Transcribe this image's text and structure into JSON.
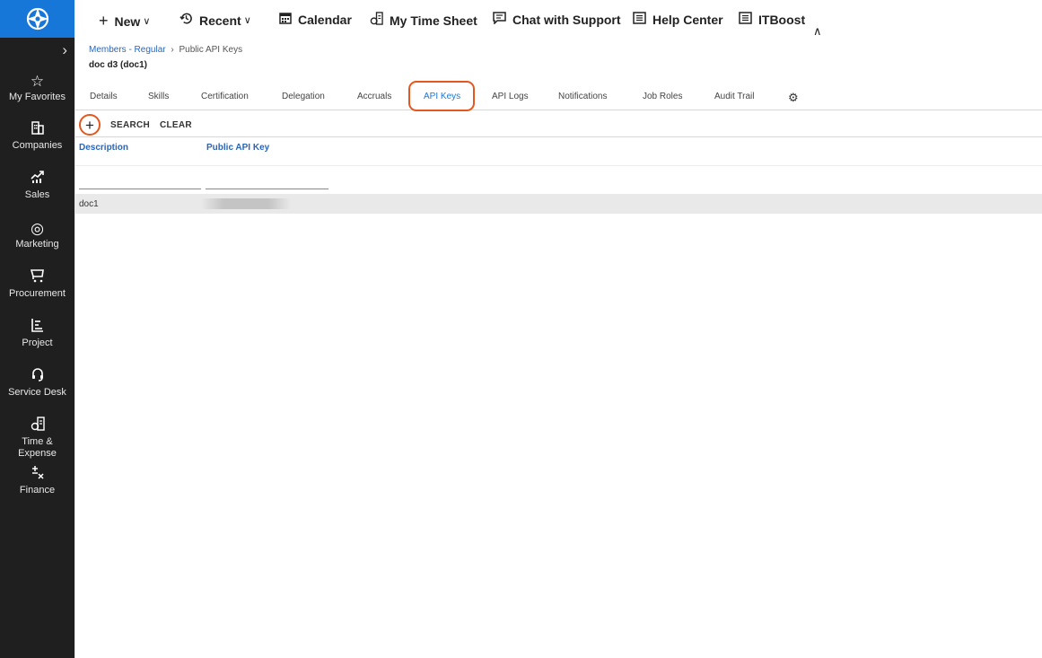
{
  "topbar": {
    "items": [
      {
        "icon": "plus-icon",
        "label": "New",
        "has_chevron": true
      },
      {
        "icon": "history-icon",
        "label": "Recent",
        "has_chevron": true
      },
      {
        "icon": "calendar-icon",
        "label": "Calendar"
      },
      {
        "icon": "timesheet-icon",
        "label": "My Time Sheet"
      },
      {
        "icon": "chat-icon",
        "label": "Chat with Support"
      },
      {
        "icon": "help-doc-icon",
        "label": "Help Center"
      },
      {
        "icon": "itboost-doc-icon",
        "label": "ITBoost"
      }
    ]
  },
  "sidebar": {
    "items": [
      {
        "icon": "star-icon",
        "label": "My Favorites"
      },
      {
        "icon": "building-icon",
        "label": "Companies"
      },
      {
        "icon": "sales-chart-icon",
        "label": "Sales"
      },
      {
        "icon": "target-icon",
        "label": "Marketing"
      },
      {
        "icon": "cart-icon",
        "label": "Procurement"
      },
      {
        "icon": "project-icon",
        "label": "Project"
      },
      {
        "icon": "headset-icon",
        "label": "Service Desk"
      },
      {
        "icon": "time-expense-icon",
        "label": "Time & Expense"
      },
      {
        "icon": "finance-icon",
        "label": "Finance"
      }
    ]
  },
  "breadcrumb": {
    "parent": "Members - Regular",
    "current": "Public API Keys"
  },
  "record": {
    "title": "doc d3 (doc1)"
  },
  "tabs": [
    {
      "label": "Details",
      "active": false
    },
    {
      "label": "Skills",
      "active": false
    },
    {
      "label": "Certification",
      "active": false
    },
    {
      "label": "Delegation",
      "active": false
    },
    {
      "label": "Accruals",
      "active": false
    },
    {
      "label": "API Keys",
      "active": true
    },
    {
      "label": "API Logs",
      "active": false
    },
    {
      "label": "Notifications",
      "active": false
    },
    {
      "label": "Job Roles",
      "active": false
    },
    {
      "label": "Audit Trail",
      "active": false
    }
  ],
  "toolbar": {
    "search_label": "SEARCH",
    "clear_label": "CLEAR"
  },
  "table": {
    "columns": [
      "Description",
      "Public API Key"
    ],
    "rows": [
      {
        "description": "doc1",
        "public_api_key": ""
      }
    ]
  },
  "colors": {
    "accent": "#1677d8",
    "sidebar_bg": "#1f1f1f",
    "highlight": "#e4571e",
    "link": "#2a66b8"
  }
}
